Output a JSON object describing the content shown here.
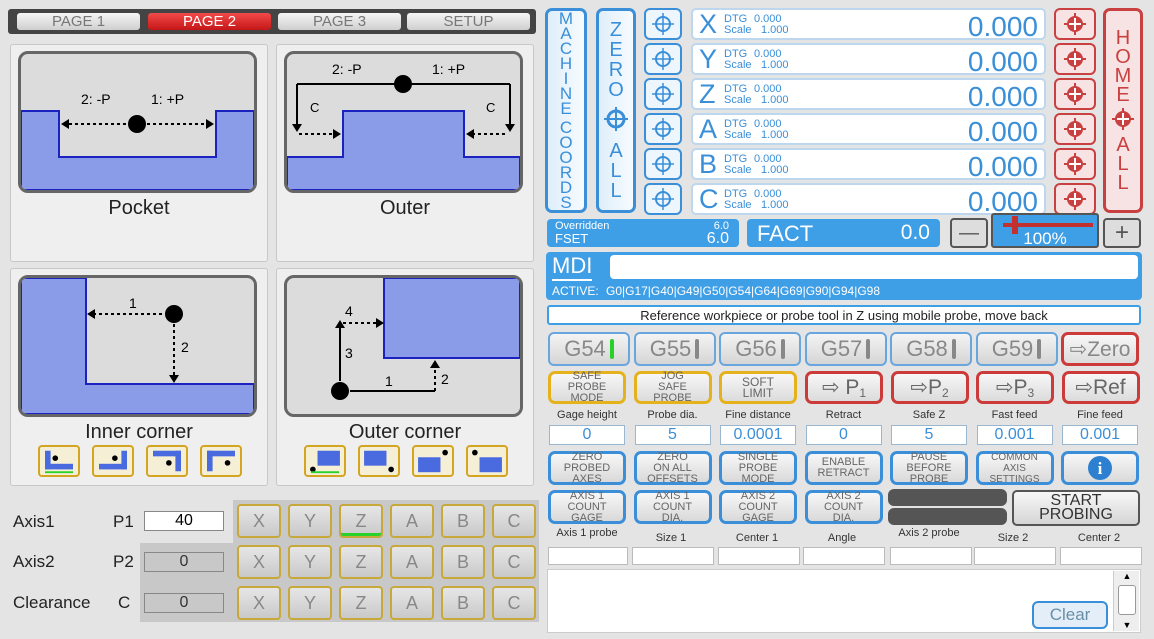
{
  "tabs": [
    "PAGE 1",
    "PAGE 2",
    "PAGE 3",
    "SETUP"
  ],
  "active_tab": "PAGE 2",
  "probe_cards": {
    "pocket": "Pocket",
    "outer": "Outer",
    "inner_corner": "Inner corner",
    "outer_corner": "Outer corner"
  },
  "illustrations": {
    "pocket_m": "2: -P",
    "pocket_p": "1: +P",
    "outer_m": "2: -P",
    "outer_p": "1: +P",
    "outer_c": "C",
    "inner_1": "1",
    "inner_2": "2",
    "oc_1": "1",
    "oc_2": "2",
    "oc_3": "3",
    "oc_4": "4"
  },
  "axis_panel": {
    "rows": [
      {
        "label": "Axis1",
        "param": "P1",
        "value": "40"
      },
      {
        "label": "Axis2",
        "param": "P2",
        "value": "0"
      },
      {
        "label": "Clearance",
        "param": "C",
        "value": "0"
      }
    ],
    "axis_buttons": [
      "X",
      "Y",
      "Z",
      "A",
      "B",
      "C"
    ]
  },
  "machine_coords": "MACHINE COORDS",
  "zero_all": [
    "Z",
    "E",
    "R",
    "O",
    "A",
    "L",
    "L"
  ],
  "home_all": [
    "H",
    "O",
    "M",
    "E",
    "A",
    "L",
    "L"
  ],
  "dro": [
    {
      "axis": "X",
      "dtg": "0.000",
      "scale": "1.000",
      "value": "0.000"
    },
    {
      "axis": "Y",
      "dtg": "0.000",
      "scale": "1.000",
      "value": "0.000"
    },
    {
      "axis": "Z",
      "dtg": "0.000",
      "scale": "1.000",
      "value": "0.000"
    },
    {
      "axis": "A",
      "dtg": "0.000",
      "scale": "1.000",
      "value": "0.000"
    },
    {
      "axis": "B",
      "dtg": "0.000",
      "scale": "1.000",
      "value": "0.000"
    },
    {
      "axis": "C",
      "dtg": "0.000",
      "scale": "1.000",
      "value": "0.000"
    }
  ],
  "dro_labels": {
    "dtg": "DTG",
    "scale": "Scale"
  },
  "feed": {
    "overridden_label": "Overridden",
    "overridden_value": "6.0",
    "fset_label": "FSET",
    "fset_value": "6.0",
    "fact_label": "FACT",
    "fact_value": "0.0",
    "override_pct": "100%",
    "override_fraction": 0.1,
    "minus": "—",
    "plus": "+"
  },
  "mdi": {
    "label": "MDI",
    "value": "",
    "active_label": "ACTIVE:",
    "active_codes": "G0|G17|G40|G49|G50|G54|G64|G69|G90|G94|G98"
  },
  "status_message": "Reference workpiece or probe tool in Z using mobile probe, move back",
  "work_offsets": [
    "G54",
    "G55",
    "G56",
    "G57",
    "G58",
    "G59"
  ],
  "active_offset": "G54",
  "zero_button": "⇨Zero",
  "probe_mode_buttons": [
    [
      "SAFE",
      "PROBE",
      "MODE"
    ],
    [
      "JOG",
      "SAFE",
      "PROBE"
    ],
    [
      "SOFT",
      "LIMIT"
    ]
  ],
  "point_buttons": [
    {
      "label": "⇨ P",
      "sub": "1"
    },
    {
      "label": "⇨P",
      "sub": "2"
    },
    {
      "label": "⇨P",
      "sub": "3"
    },
    {
      "label": "⇨Ref",
      "sub": ""
    }
  ],
  "params": [
    {
      "label": "Gage height",
      "value": "0"
    },
    {
      "label": "Probe dia.",
      "value": "5"
    },
    {
      "label": "Fine distance",
      "value": "0.0001"
    },
    {
      "label": "Retract",
      "value": "0"
    },
    {
      "label": "Safe Z",
      "value": "5"
    },
    {
      "label": "Fast feed",
      "value": "0.001"
    },
    {
      "label": "Fine feed",
      "value": "0.001"
    }
  ],
  "option_buttons": [
    [
      "ZERO",
      "PROBED",
      "AXES"
    ],
    [
      "ZERO",
      "ON ALL",
      "OFFSETS"
    ],
    [
      "SINGLE",
      "PROBE",
      "MODE"
    ],
    [
      "ENABLE",
      "RETRACT"
    ],
    [
      "PAUSE",
      "BEFORE",
      "PROBE"
    ],
    [
      "COMMON",
      "AXIS",
      "SETTINGS"
    ]
  ],
  "info_icon": "i",
  "count_buttons": [
    [
      "AXIS 1",
      "COUNT",
      "GAGE"
    ],
    [
      "AXIS 1",
      "COUNT",
      "DIA."
    ],
    [
      "AXIS 2",
      "COUNT",
      "GAGE"
    ],
    [
      "AXIS 2",
      "COUNT",
      "DIA."
    ]
  ],
  "start_probing": [
    "START",
    "PROBING"
  ],
  "results_labels": [
    "Axis 1 probe",
    "Size 1",
    "Center 1",
    "Angle",
    "Axis 2 probe",
    "Size 2",
    "Center 2"
  ],
  "clear_button": "Clear",
  "colors": {
    "accent": "#3a8fd8",
    "active_tab": "#d82020",
    "red": "#cc3a3a",
    "yellow": "#e5b21e",
    "green": "#26d12a"
  }
}
